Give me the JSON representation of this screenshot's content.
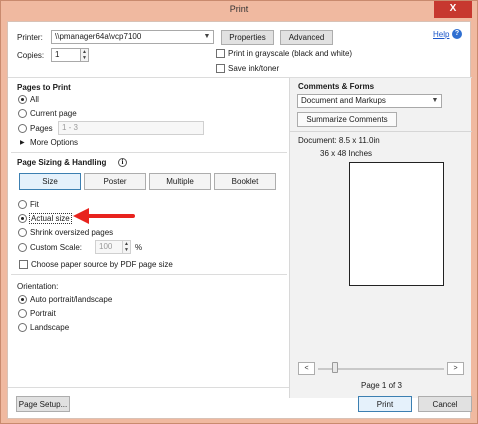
{
  "window": {
    "title": "Print",
    "close_glyph": "X"
  },
  "printer": {
    "label": "Printer:",
    "selected": "\\\\pmanager64a\\vcp7100",
    "properties_label": "Properties",
    "advanced_label": "Advanced",
    "help_label": "Help",
    "help_icon": "question-circle-icon"
  },
  "copies": {
    "label": "Copies:",
    "value": "1"
  },
  "options": {
    "grayscale_label": "Print in grayscale (black and white)",
    "grayscale_checked": false,
    "save_ink_label": "Save ink/toner",
    "save_ink_checked": false
  },
  "pages_to_print": {
    "header": "Pages to Print",
    "all_label": "All",
    "current_label": "Current page",
    "pages_label": "Pages",
    "pages_value": "1 - 3",
    "selected": "All",
    "more_options_label": "More Options"
  },
  "page_sizing": {
    "header": "Page Sizing & Handling",
    "info_icon": "info-icon",
    "buttons": [
      "Size",
      "Poster",
      "Multiple",
      "Booklet"
    ],
    "active_button": "Size",
    "fit_label": "Fit",
    "actual_label": "Actual size",
    "shrink_label": "Shrink oversized pages",
    "custom_label": "Custom Scale:",
    "custom_value": "100",
    "custom_unit": "%",
    "selected": "Actual size",
    "paper_source_label": "Choose paper source by PDF page size",
    "paper_source_checked": false,
    "annotation_color": "#e8231e"
  },
  "orientation": {
    "header": "Orientation:",
    "auto_label": "Auto portrait/landscape",
    "portrait_label": "Portrait",
    "landscape_label": "Landscape",
    "selected": "Auto portrait/landscape"
  },
  "comments": {
    "header": "Comments & Forms",
    "selected": "Document and Markups",
    "summarize_label": "Summarize Comments"
  },
  "preview": {
    "document_label": "Document: 8.5 x 11.0in",
    "size_label": "36 x 48 Inches",
    "page_label": "Page 1 of 3",
    "prev_glyph": "<",
    "next_glyph": ">"
  },
  "footer": {
    "page_setup_label": "Page Setup...",
    "print_label": "Print",
    "cancel_label": "Cancel"
  }
}
